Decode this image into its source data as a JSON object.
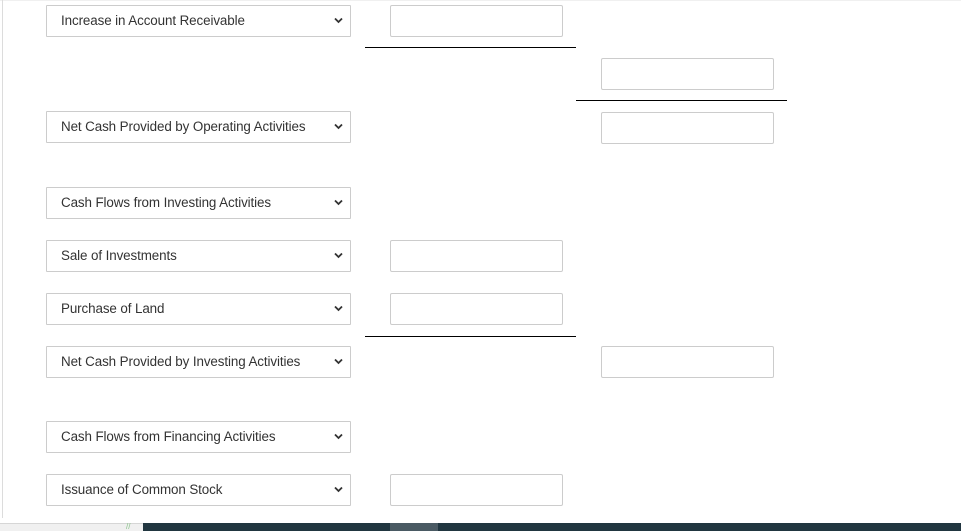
{
  "statement": {
    "rows": [
      {
        "label": "Increase in Account Receivable"
      },
      {
        "label": "Net Cash Provided by Operating Activities"
      },
      {
        "label": "Cash Flows from Investing Activities"
      },
      {
        "label": "Sale of Investments"
      },
      {
        "label": "Purchase of Land"
      },
      {
        "label": "Net Cash Provided by Investing Activities"
      },
      {
        "label": "Cash Flows from Financing Activities"
      },
      {
        "label": "Issuance of Common Stock"
      }
    ],
    "inputs": {
      "ar_increase": "",
      "operating_subtotal": "",
      "net_operating": "",
      "sale_investments": "",
      "purchase_land": "",
      "net_investing": "",
      "common_stock": ""
    }
  },
  "icons": {
    "dropdown": "chevron-down-icon"
  },
  "colors": {
    "border": "#cccccc",
    "text": "#333333",
    "taskbar": "#213640"
  }
}
